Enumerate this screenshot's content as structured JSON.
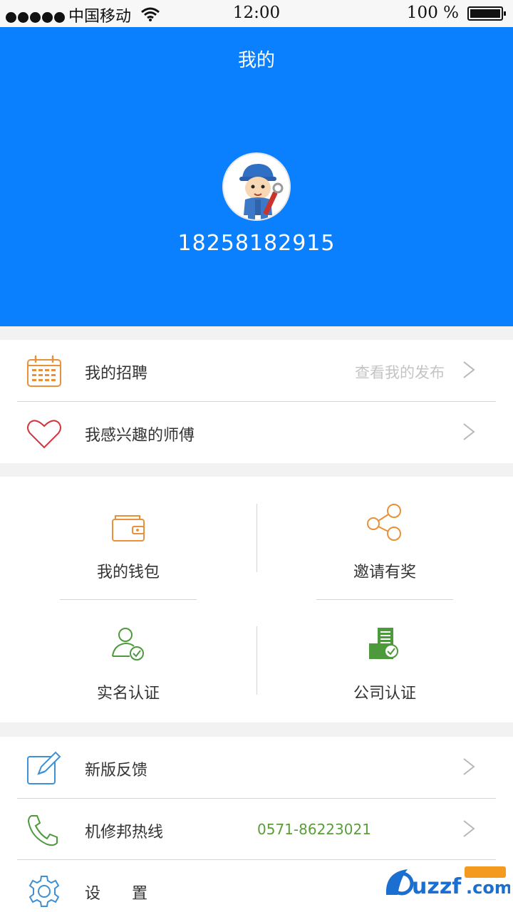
{
  "status_bar": {
    "carrier": "中国移动",
    "time": "12:00",
    "battery": "100 %"
  },
  "header": {
    "title": "我的",
    "phone": "18258182915",
    "background": "#0a80ff"
  },
  "section1": {
    "items": [
      {
        "label": "我的招聘",
        "hint": "查看我的发布",
        "icon": "calendar-icon"
      },
      {
        "label": "我感兴趣的师傅",
        "hint": "",
        "icon": "heart-icon"
      }
    ]
  },
  "grid": {
    "items": [
      {
        "label": "我的钱包",
        "icon": "wallet-icon"
      },
      {
        "label": "邀请有奖",
        "icon": "share-icon"
      },
      {
        "label": "实名认证",
        "icon": "user-verified-icon"
      },
      {
        "label": "公司认证",
        "icon": "company-verified-icon"
      }
    ]
  },
  "section2": {
    "items": [
      {
        "label": "新版反馈",
        "icon": "edit-icon"
      },
      {
        "label": "机修邦热线",
        "value": "0571-86223021",
        "icon": "phone-icon"
      },
      {
        "label": "设　　置",
        "icon": "gear-icon"
      }
    ]
  },
  "colors": {
    "accent_blue": "#0a80ff",
    "hotline_green": "#5a9e3a",
    "icon_orange": "#e8913a",
    "icon_red": "#d0363c",
    "icon_blue": "#3f8fd2",
    "icon_green": "#4d9a3c"
  }
}
